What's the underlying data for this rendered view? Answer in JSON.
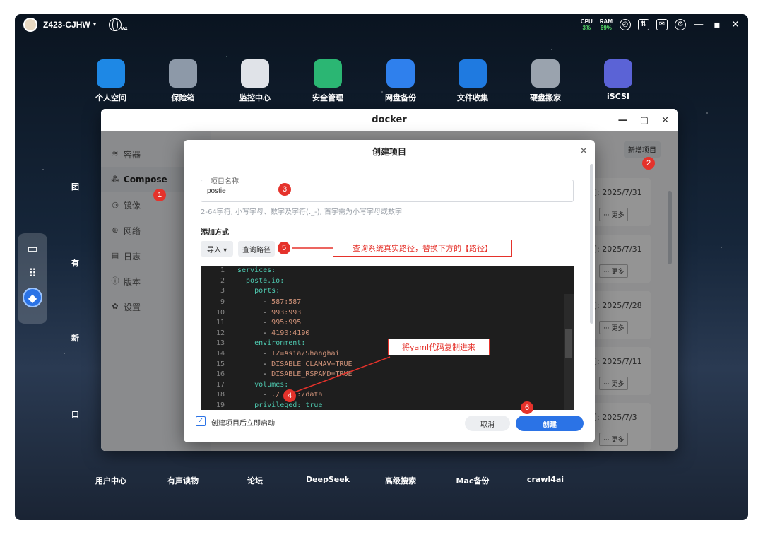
{
  "topbar": {
    "hostname": "Z423-CJHW",
    "globe_sub": "V4",
    "cpu_label": "CPU",
    "cpu_value": "3%",
    "ram_label": "RAM",
    "ram_value": "69%"
  },
  "desktop": {
    "top_icons": [
      {
        "label": "个人空间",
        "color": "#1e88e5",
        "icon": "folder-icon"
      },
      {
        "label": "保险箱",
        "color": "#8d99a8",
        "icon": "safe-icon"
      },
      {
        "label": "监控中心",
        "color": "#e0e3e8",
        "icon": "camera-icon"
      },
      {
        "label": "安全管理",
        "color": "#2bb673",
        "icon": "shield-icon"
      },
      {
        "label": "网盘备份",
        "color": "#2f80ed",
        "icon": "cloud-icon"
      },
      {
        "label": "文件收集",
        "color": "#1f7ae0",
        "icon": "inbox-icon"
      },
      {
        "label": "硬盘搬家",
        "color": "#9aa3ae",
        "icon": "disk-icon"
      },
      {
        "label": "iSCSI",
        "color": "#5b63d6",
        "icon": "iscsi-icon"
      }
    ],
    "bottom_icons": [
      {
        "label": "用户中心"
      },
      {
        "label": "有声读物"
      },
      {
        "label": "论坛"
      },
      {
        "label": "DeepSeek"
      },
      {
        "label": "高级搜索"
      },
      {
        "label": "Mac备份"
      },
      {
        "label": "crawl4ai"
      }
    ],
    "partial_labels": [
      "团",
      "有",
      "新",
      "口"
    ]
  },
  "docker": {
    "title": "docker",
    "sidebar": [
      {
        "label": "容器",
        "icon": "layers-icon"
      },
      {
        "label": "Compose",
        "icon": "compose-icon"
      },
      {
        "label": "镜像",
        "icon": "image-icon"
      },
      {
        "label": "网络",
        "icon": "network-icon"
      },
      {
        "label": "日志",
        "icon": "log-icon"
      },
      {
        "label": "版本",
        "icon": "info-icon"
      },
      {
        "label": "设置",
        "icon": "gear-icon"
      }
    ],
    "new_project_label": "新增项目",
    "projects": [
      {
        "date": "间: 2025/7/31",
        "more": "··· 更多"
      },
      {
        "date": "间: 2025/7/31",
        "more": "··· 更多"
      },
      {
        "date": "间: 2025/7/28",
        "more": "··· 更多"
      },
      {
        "date": "间: 2025/7/11",
        "more": "··· 更多"
      },
      {
        "date": "间: 2025/7/3",
        "more": "··· 更多"
      }
    ]
  },
  "modal": {
    "title": "创建项目",
    "name_legend": "项目名称",
    "name_value": "postie",
    "hint": "2-64字符, 小写字母、数字及字符(._-), 首字需为小写字母或数字",
    "add_method_label": "添加方式",
    "import_label": "导入 ▾",
    "query_path_label": "查询路径",
    "code_sticky": [
      {
        "n": "1",
        "text": "services:"
      },
      {
        "n": "2",
        "text": "  poste.io:"
      },
      {
        "n": "3",
        "text": "    ports:"
      }
    ],
    "code_lines": [
      {
        "n": "9",
        "dash": "      - ",
        "text": "587:587",
        "cls": "str"
      },
      {
        "n": "10",
        "dash": "      - ",
        "text": "993:993",
        "cls": "str"
      },
      {
        "n": "11",
        "dash": "      - ",
        "text": "995:995",
        "cls": "str"
      },
      {
        "n": "12",
        "dash": "      - ",
        "text": "4190:4190",
        "cls": "str"
      },
      {
        "n": "13",
        "dash": "    ",
        "text": "environment:",
        "cls": "key"
      },
      {
        "n": "14",
        "dash": "      - ",
        "text": "TZ=Asia/Shanghai",
        "cls": "str"
      },
      {
        "n": "15",
        "dash": "      - ",
        "text": "DISABLE_CLAMAV=TRUE",
        "cls": "str"
      },
      {
        "n": "16",
        "dash": "      - ",
        "text": "DISABLE_RSPAMD=TRUE",
        "cls": "str"
      },
      {
        "n": "17",
        "dash": "    ",
        "text": "volumes:",
        "cls": "key"
      },
      {
        "n": "18",
        "dash": "      - ",
        "text": "./   l:/data",
        "cls": "str"
      },
      {
        "n": "19",
        "dash": "    ",
        "text": "privileged: true",
        "cls": "key"
      }
    ],
    "autostart_label": "创建项目后立即启动",
    "cancel_label": "取消",
    "create_label": "创建"
  },
  "annotations": {
    "badges": [
      "1",
      "2",
      "3",
      "4",
      "5",
      "6"
    ],
    "callout_path": "查询系统真实路径，替换下方的【路径】",
    "callout_yaml": "将yaml代码复制进来",
    "color": "#e5322b"
  }
}
